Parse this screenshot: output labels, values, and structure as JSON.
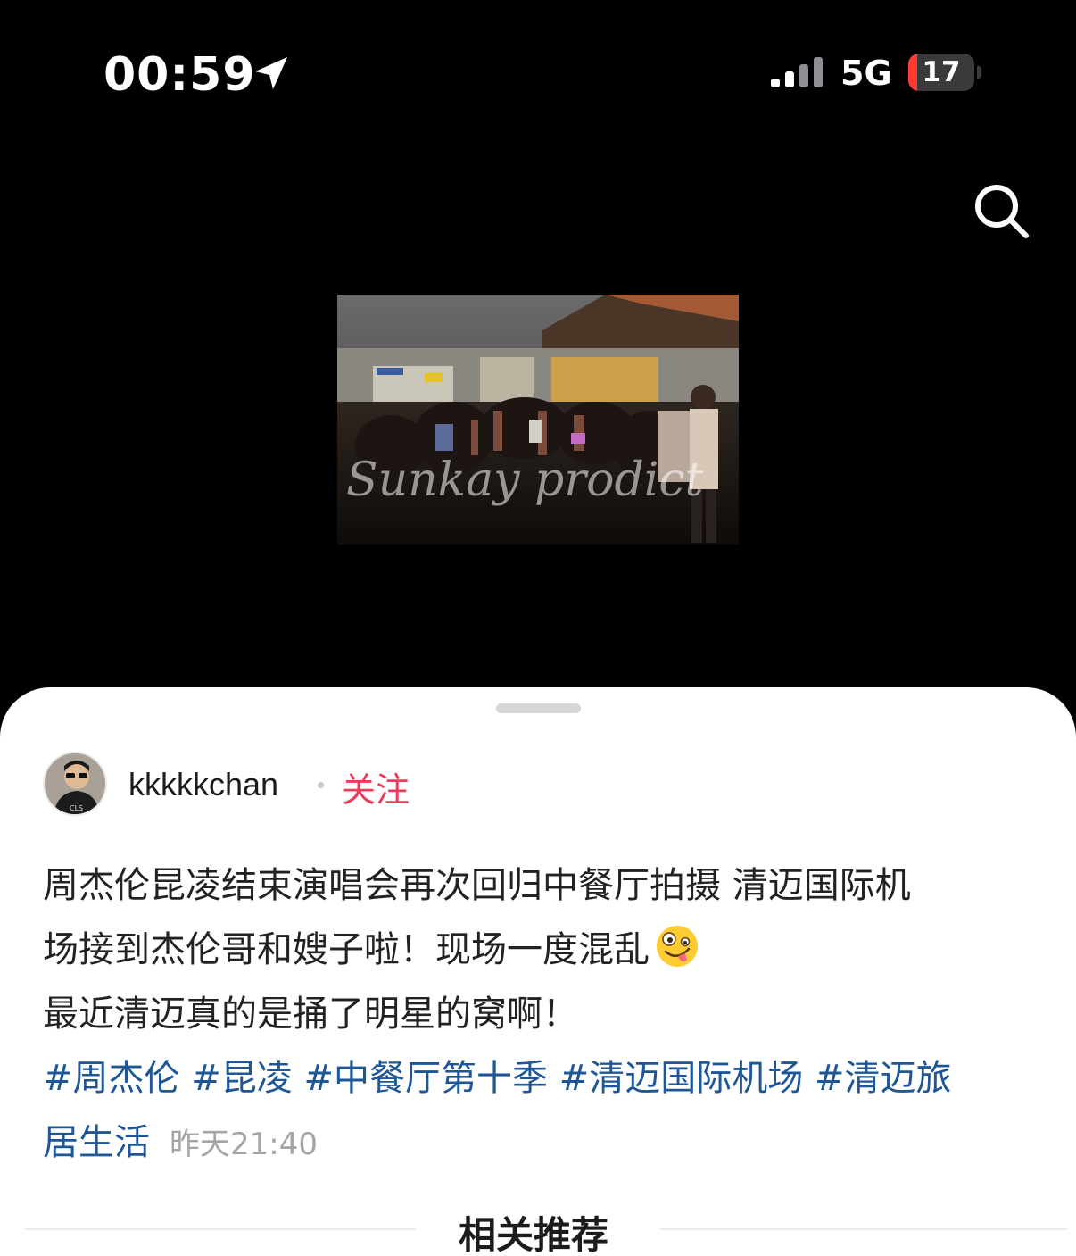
{
  "status_bar": {
    "time": "00:59",
    "network": "5G",
    "battery": "17",
    "battery_color": "#ff3b30",
    "location_icon": "location-arrow-icon",
    "signal_icon": "cellular-signal-icon"
  },
  "header": {
    "search_icon": "search-icon"
  },
  "video": {
    "watermark": "Sunkay prodict"
  },
  "post": {
    "username": "kkkkkchan",
    "follow_label": "关注",
    "follow_color": "#ee3b5b",
    "text_lines": [
      "周杰伦昆凌结束演唱会再次回归中餐厅拍摄 清迈国际机",
      "场接到杰伦哥和嫂子啦！现场一度混乱",
      "最近清迈真的是捅了明星的窝啊！"
    ],
    "emoji": "zany-face-emoji",
    "hashtags": [
      "#周杰伦",
      "#昆凌",
      "#中餐厅第十季",
      "#清迈国际机场",
      "#清迈旅",
      "居生活"
    ],
    "hashtag_color": "#1e5696",
    "timestamp": "昨天21:40"
  },
  "related": {
    "title": "相关推荐"
  }
}
